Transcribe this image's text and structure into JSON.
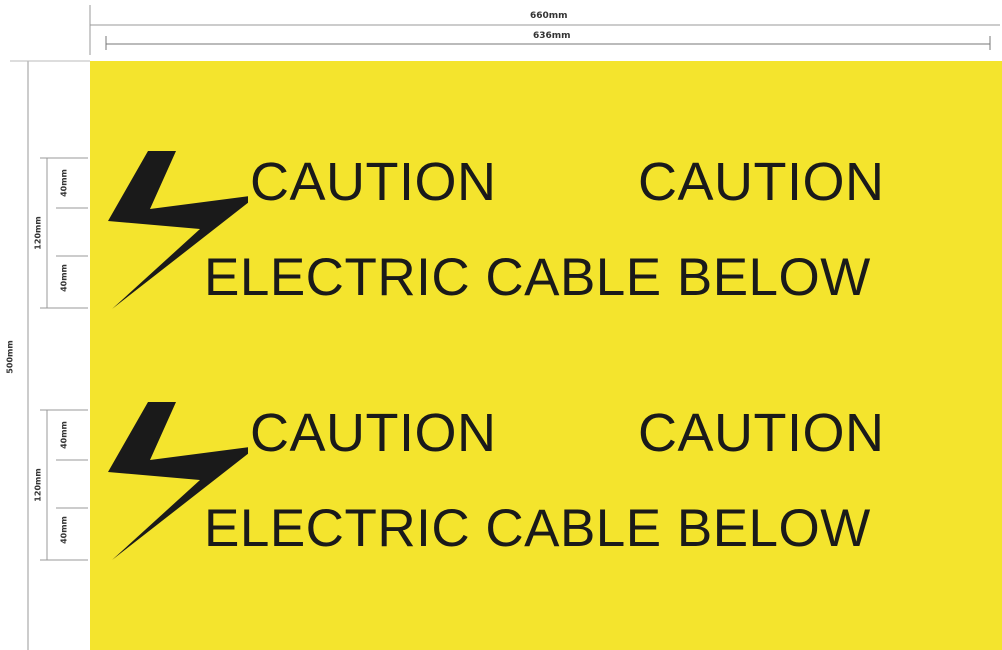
{
  "dimensions": {
    "overall_width": "660mm",
    "inner_width": "636mm",
    "overall_height": "500mm",
    "band_height": "120mm",
    "text_height": "40mm"
  },
  "sign": {
    "background_color": "#f4e42d",
    "text_color": "#1a1a1a",
    "bands": [
      {
        "line1": [
          "CAUTION",
          "CAUTION"
        ],
        "line2": "ELECTRIC CABLE BELOW",
        "icon": "lightning-bolt-icon"
      },
      {
        "line1": [
          "CAUTION",
          "CAUTION"
        ],
        "line2": "ELECTRIC CABLE BELOW",
        "icon": "lightning-bolt-icon"
      }
    ]
  }
}
